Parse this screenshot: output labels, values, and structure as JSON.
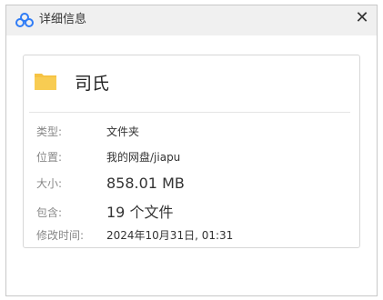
{
  "window": {
    "title": "详细信息",
    "close_symbol": "✕"
  },
  "item": {
    "name": "司氏",
    "icon": "folder-icon",
    "folder_color": "#f6c343"
  },
  "details": {
    "type_label": "类型:",
    "type_value": "文件夹",
    "location_label": "位置:",
    "location_value": "我的网盘/jiapu",
    "size_label": "大小:",
    "size_value": "858.01 MB",
    "contains_label": "包含:",
    "contains_value": "19 个文件",
    "modified_label": "修改时间:",
    "modified_value": "2024年10月31日, 01:31"
  },
  "colors": {
    "brand_blue": "#2f7cf6",
    "label_gray": "#888888"
  }
}
